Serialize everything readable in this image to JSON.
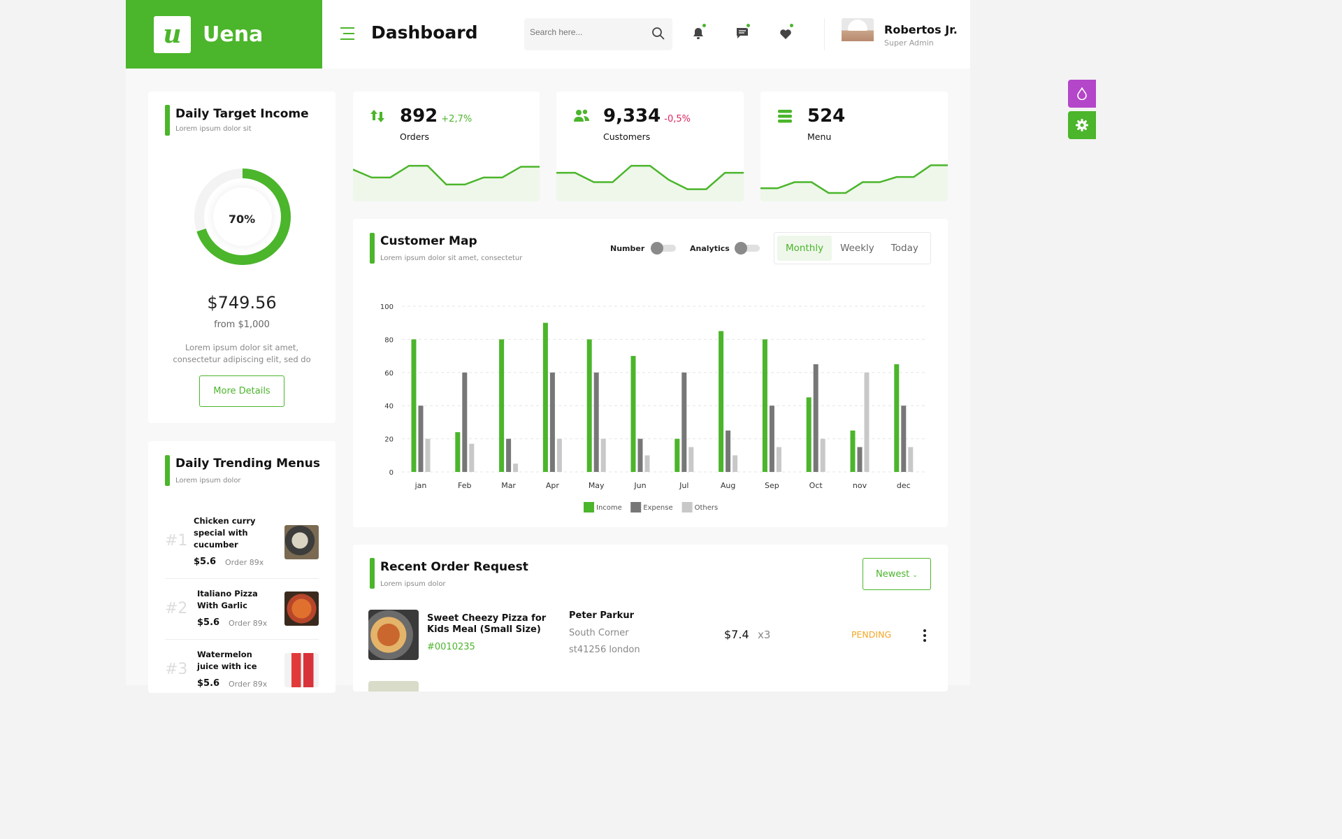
{
  "brand": {
    "logo_letter": "u",
    "name": "Uena",
    "color": "#4bb52b"
  },
  "header": {
    "title": "Dashboard",
    "search_placeholder": "Search here...",
    "user_name": "Robertos Jr.",
    "user_role": "Super Admin"
  },
  "daily_target": {
    "title": "Daily Target Income",
    "subtitle": "Lorem ipsum dolor sit",
    "percent": 70,
    "percent_label": "70%",
    "amount": "$749.56",
    "from": "from $1,000",
    "description": "Lorem ipsum dolor sit amet, consectetur adipiscing elit, sed do",
    "button": "More Details"
  },
  "trending": {
    "title": "Daily Trending Menus",
    "subtitle": "Lorem ipsum dolor",
    "items": [
      {
        "rank": "#1",
        "name": "Chicken curry special with cucumber",
        "price": "$5.6",
        "orders": "Order 89x"
      },
      {
        "rank": "#2",
        "name": "Italiano Pizza With Garlic",
        "price": "$5.6",
        "orders": "Order 89x"
      },
      {
        "rank": "#3",
        "name": "Watermelon juice with ice",
        "price": "$5.6",
        "orders": "Order 89x"
      }
    ]
  },
  "stats": [
    {
      "value": "892",
      "change": "+2,7%",
      "change_color": "#4bb52b",
      "label": "Orders",
      "icon": "arrows-up-down-icon",
      "spark": [
        62,
        45,
        45,
        70,
        70,
        30,
        30,
        45,
        45,
        68,
        68
      ]
    },
    {
      "value": "9,334",
      "change": "-0,5%",
      "change_color": "#e0245e",
      "label": "Customers",
      "icon": "users-icon",
      "spark": [
        55,
        55,
        35,
        35,
        70,
        70,
        40,
        20,
        20,
        55,
        55
      ]
    },
    {
      "value": "524",
      "change": "",
      "change_color": "#4bb52b",
      "label": "Menu",
      "icon": "menu-list-icon",
      "spark": [
        22,
        22,
        35,
        35,
        12,
        12,
        35,
        35,
        46,
        46,
        71,
        71
      ]
    }
  ],
  "customer_map": {
    "title": "Customer Map",
    "subtitle": "Lorem ipsum dolor sit amet, consectetur",
    "toggle_number": "Number",
    "toggle_analytics": "Analytics",
    "tabs": [
      "Monthly",
      "Weekly",
      "Today"
    ],
    "active_tab": 0
  },
  "chart_data": {
    "type": "bar",
    "categories": [
      "jan",
      "Feb",
      "Mar",
      "Apr",
      "May",
      "Jun",
      "Jul",
      "Aug",
      "Sep",
      "Oct",
      "nov",
      "dec"
    ],
    "series": [
      {
        "name": "Income",
        "color": "#4bb52b",
        "values": [
          80,
          24,
          80,
          90,
          80,
          70,
          20,
          85,
          80,
          45,
          25,
          65
        ]
      },
      {
        "name": "Expense",
        "color": "#777777",
        "values": [
          40,
          60,
          20,
          60,
          60,
          20,
          60,
          25,
          40,
          65,
          15,
          40
        ]
      },
      {
        "name": "Others",
        "color": "#c8c8c8",
        "values": [
          20,
          17,
          5,
          20,
          20,
          10,
          15,
          10,
          15,
          20,
          60,
          15
        ]
      }
    ],
    "ylim": [
      0,
      100
    ],
    "yticks": [
      0,
      20,
      40,
      60,
      80,
      100
    ],
    "grid": true,
    "legend": "bottom-center"
  },
  "recent_orders": {
    "title": "Recent Order Request",
    "subtitle": "Lorem ipsum dolor",
    "sort_button": "Newest",
    "items": [
      {
        "name": "Sweet Cheezy Pizza for Kids Meal (Small Size)",
        "id": "#0010235",
        "customer": "Peter Parkur",
        "address_1": "South Corner",
        "address_2": "st41256 london",
        "price": "$7.4",
        "qty": "x3",
        "status": "PENDING"
      }
    ]
  }
}
